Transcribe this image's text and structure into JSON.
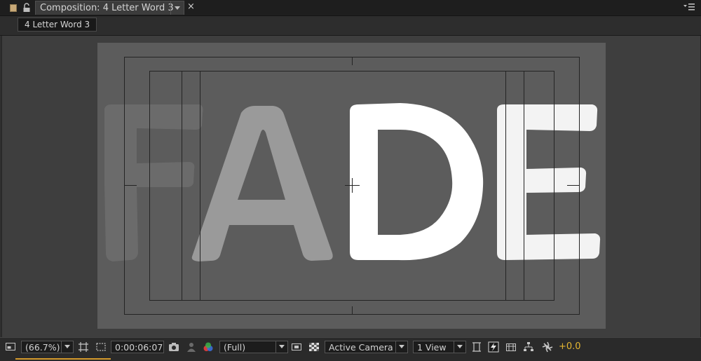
{
  "tab": {
    "title": "Composition: 4 Letter Word 3",
    "close_glyph": "×",
    "icons": [
      "composition-icon",
      "lock-icon",
      "chevron-down-icon",
      "panel-menu-icon"
    ]
  },
  "breadcrumb": {
    "label": "4 Letter Word 3"
  },
  "canvas": {
    "letters": [
      "F",
      "A",
      "D",
      "E"
    ],
    "letter_fill": {
      "F": "#6b6b6b",
      "A": "#9a9a9a",
      "D": "#ffffff",
      "E": "#f3f3f3"
    },
    "background": "#5c5c5c"
  },
  "status_bar": {
    "magnification": "(66.7%)",
    "timecode": "0:00:06:07",
    "resolution": "(Full)",
    "camera": "Active Camera",
    "views": "1 View",
    "exposure": "+0.0",
    "accent_color": "#e4b631",
    "icons": [
      "always-preview-icon",
      "region-of-interest-icon",
      "transparency-grid-icon",
      "snapshot-icon",
      "show-snapshot-icon",
      "color-channels-icon",
      "toggle-mask-icon",
      "checkerboard-icon",
      "pixel-aspect-icon",
      "fast-previews-icon",
      "timeline-icon",
      "flowchart-icon",
      "reset-exposure-icon"
    ]
  }
}
